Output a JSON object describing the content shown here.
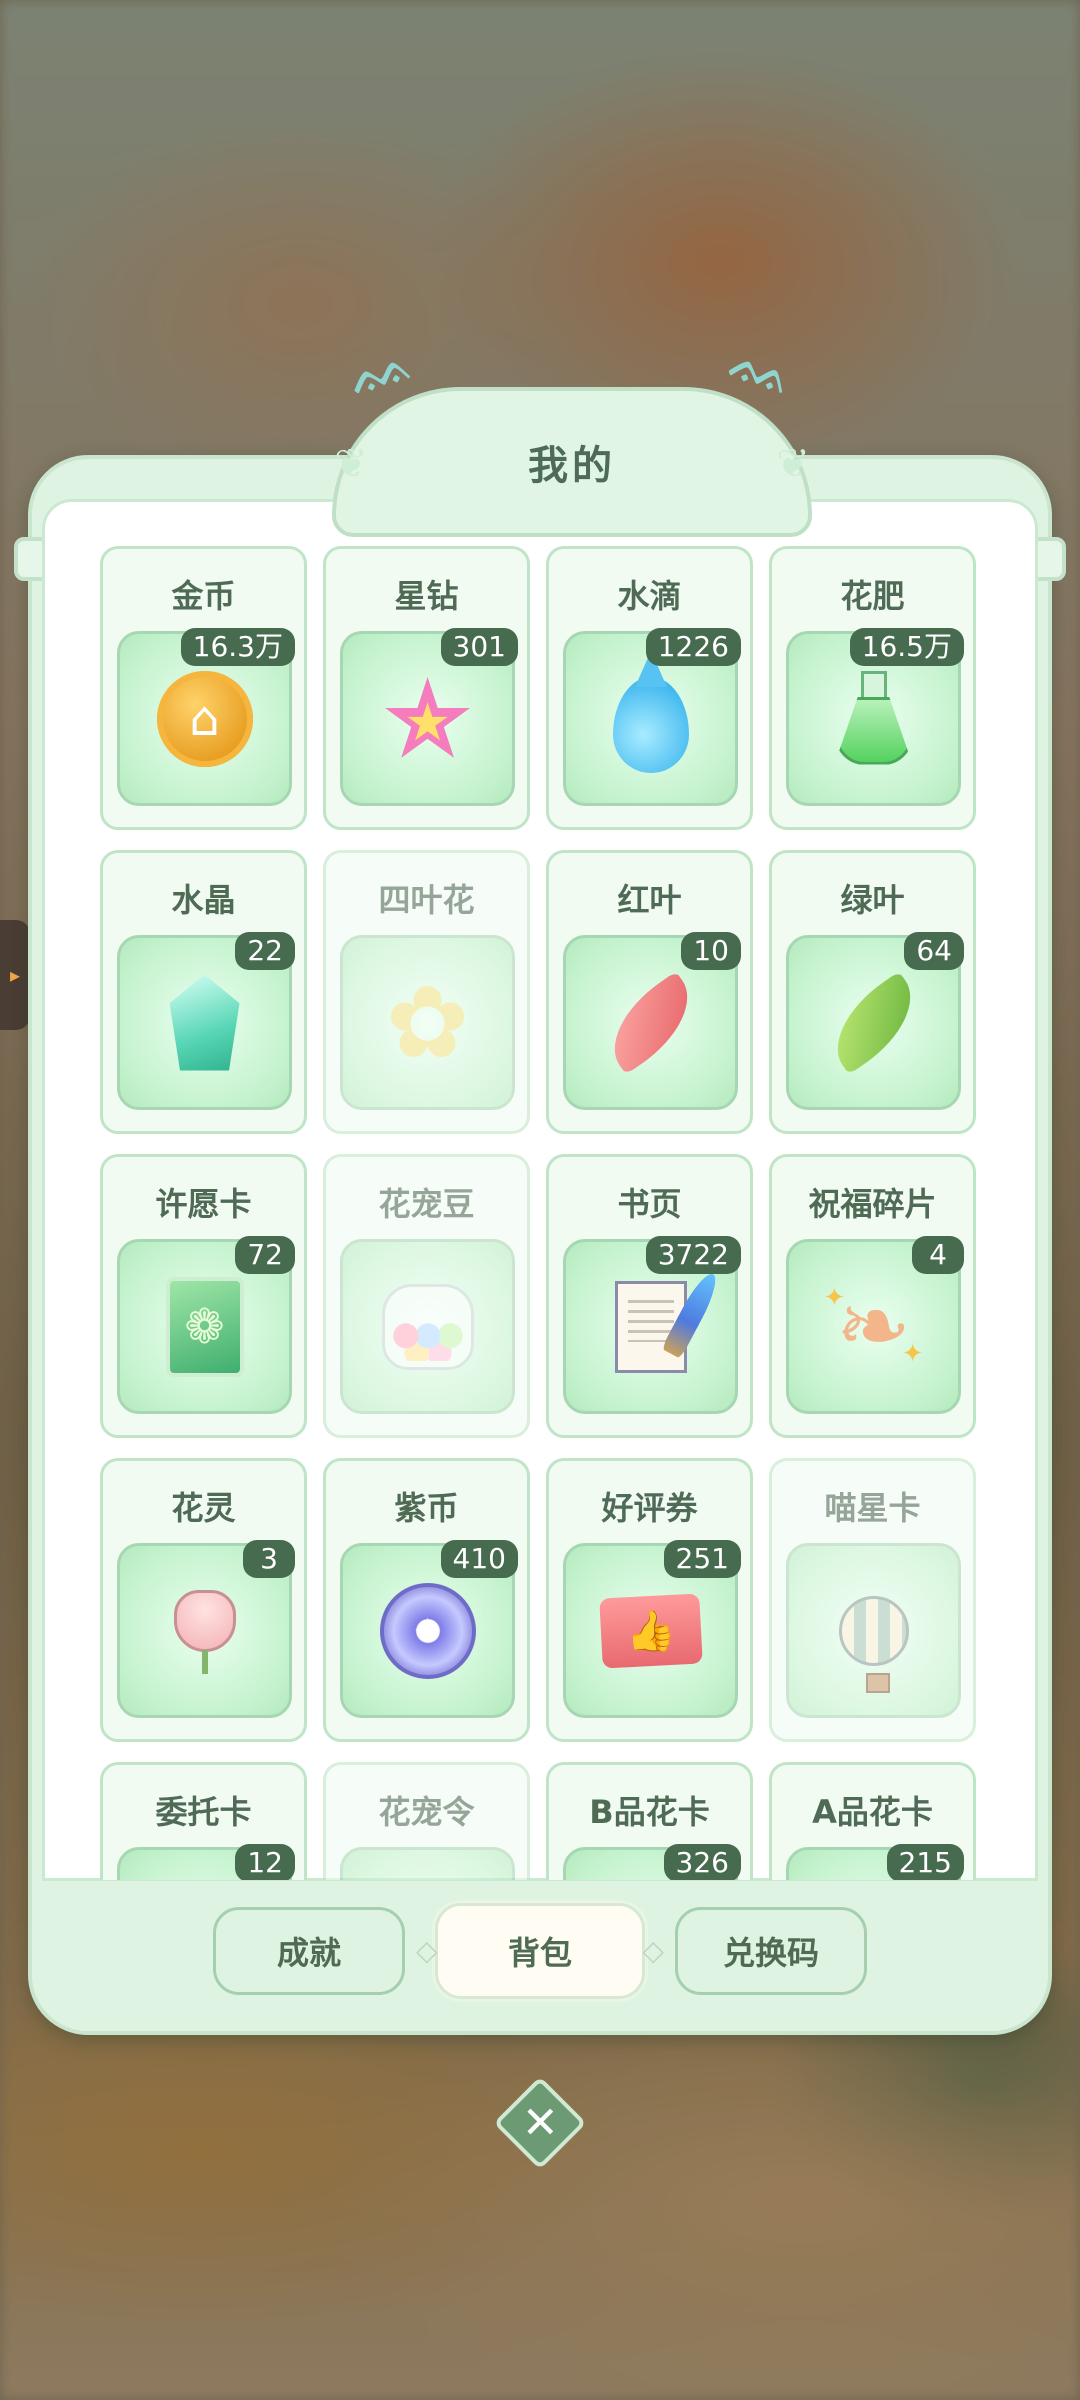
{
  "panel": {
    "title": "我的"
  },
  "items": [
    {
      "name": "金币",
      "count": "16.3万",
      "icon": "gold-coin-icon",
      "faded": false
    },
    {
      "name": "星钻",
      "count": "301",
      "icon": "star-diamond-icon",
      "faded": false
    },
    {
      "name": "水滴",
      "count": "1226",
      "icon": "water-drop-icon",
      "faded": false
    },
    {
      "name": "花肥",
      "count": "16.5万",
      "icon": "fertilizer-flask-icon",
      "faded": false
    },
    {
      "name": "水晶",
      "count": "22",
      "icon": "crystal-icon",
      "faded": false
    },
    {
      "name": "四叶花",
      "count": "",
      "icon": "four-leaf-clover-icon",
      "faded": true
    },
    {
      "name": "红叶",
      "count": "10",
      "icon": "red-leaf-icon",
      "faded": false
    },
    {
      "name": "绿叶",
      "count": "64",
      "icon": "green-leaf-icon",
      "faded": false
    },
    {
      "name": "许愿卡",
      "count": "72",
      "icon": "wish-card-icon",
      "faded": false
    },
    {
      "name": "花宠豆",
      "count": "",
      "icon": "candy-jar-icon",
      "faded": true
    },
    {
      "name": "书页",
      "count": "3722",
      "icon": "book-page-quill-icon",
      "faded": false
    },
    {
      "name": "祝福碎片",
      "count": "4",
      "icon": "blessing-fragment-icon",
      "faded": false
    },
    {
      "name": "花灵",
      "count": "3",
      "icon": "flower-spirit-tulip-icon",
      "faded": false
    },
    {
      "name": "紫币",
      "count": "410",
      "icon": "purple-coin-icon",
      "faded": false
    },
    {
      "name": "好评券",
      "count": "251",
      "icon": "thumbs-up-ticket-icon",
      "faded": false
    },
    {
      "name": "喵星卡",
      "count": "",
      "icon": "hot-air-balloon-icon",
      "faded": true
    },
    {
      "name": "委托卡",
      "count": "12",
      "icon": "commission-card-icon",
      "faded": false
    },
    {
      "name": "花宠令",
      "count": "",
      "icon": "pet-token-icon",
      "faded": true
    },
    {
      "name": "B品花卡",
      "count": "326",
      "icon": "b-grade-flower-card-icon",
      "faded": false
    },
    {
      "name": "A品花卡",
      "count": "215",
      "icon": "a-grade-flower-card-icon",
      "faded": false
    }
  ],
  "tabs": [
    {
      "label": "成就",
      "active": false
    },
    {
      "label": "背包",
      "active": true
    },
    {
      "label": "兑换码",
      "active": false
    }
  ],
  "close": {
    "icon": "close-x-icon",
    "glyph": "✕"
  },
  "side_tab": {
    "icon": "arrow-right-icon",
    "glyph": "▸"
  },
  "colors": {
    "panel_bg": "#dff3e2",
    "card_border": "#bfe5c6",
    "badge_bg": "#466b4f",
    "label_text": "#4f6b55"
  }
}
